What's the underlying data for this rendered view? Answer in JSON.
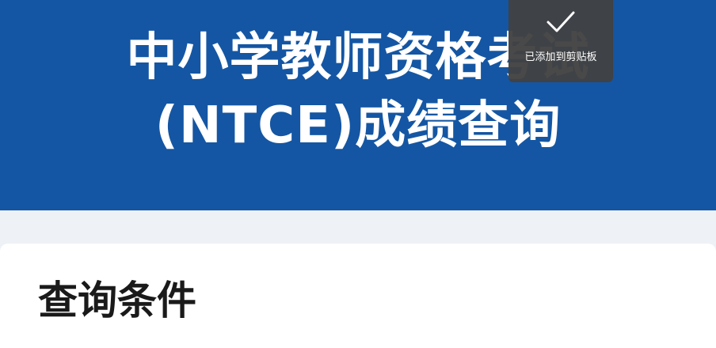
{
  "header": {
    "title_line1": "中小学教师资格考试",
    "title_line2": "(NTCE)成绩查询"
  },
  "query_card": {
    "title": "查询条件"
  },
  "toast": {
    "icon": "checkmark-icon",
    "message": "已添加到剪贴板"
  },
  "colors": {
    "header_bg": "#1456a3",
    "page_bg": "#eef1f5",
    "toast_bg": "#424242"
  }
}
